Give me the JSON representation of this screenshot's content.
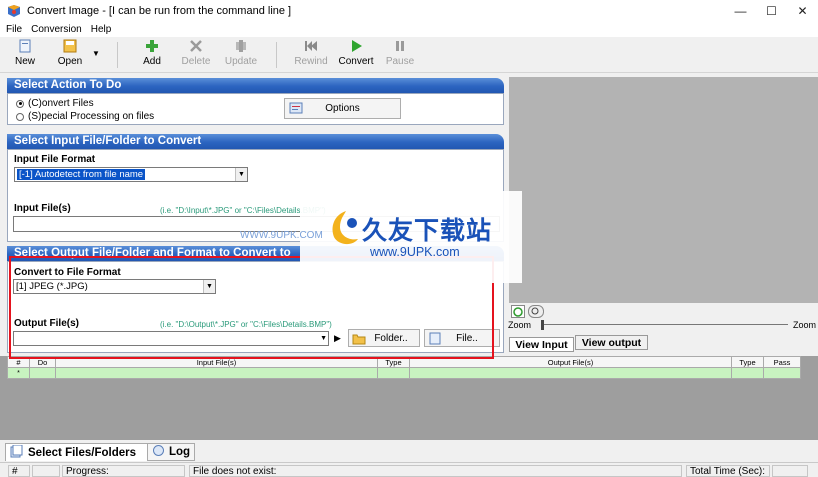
{
  "window": {
    "title": "Convert Image - [I can be run from the command line ]",
    "controls": [
      "—",
      "☐",
      "✕"
    ]
  },
  "menu": [
    "File",
    "Conversion",
    "Help"
  ],
  "toolbar": {
    "new": "New",
    "open": "Open",
    "add": "Add",
    "delete": "Delete",
    "update": "Update",
    "rewind": "Rewind",
    "convert": "Convert",
    "pause": "Pause"
  },
  "action": {
    "header": "Select Action To Do",
    "radio1": "(C)onvert Files",
    "radio2": "(S)pecial Processing on files",
    "options_button": "Options"
  },
  "input": {
    "header": "Select Input File/Folder to Convert",
    "format_label": "Input File Format",
    "format_value": "[-1] Autodetect from file name",
    "files_label": "Input File(s)",
    "hint": "(i.e. \"D:\\Input\\*.JPG\" or \"C:\\Files\\Details.BMP\")",
    "files_value": ""
  },
  "output": {
    "header": "Select Output File/Folder and Format to Convert to",
    "format_label": "Convert to File Format",
    "format_value": "[1] JPEG (*.JPG)",
    "files_label": "Output File(s)",
    "hint": "(i.e. \"D:\\Output\\*.JPG\" or \"C:\\Files\\Details.BMP\")",
    "files_value": "",
    "folder_button": "Folder..",
    "file_button": "File.."
  },
  "preview": {
    "zoom_left": "Zoom",
    "zoom_right": "Zoom",
    "view_input": "View Input",
    "view_output": "View output"
  },
  "grid": {
    "columns": [
      "#",
      "Do",
      "Input File(s)",
      "Type",
      "Output File(s)",
      "Type",
      "Pass"
    ],
    "new_row_marker": "*"
  },
  "tabs": {
    "select_files": "Select Files/Folders",
    "log": "Log"
  },
  "status": {
    "hash": "#",
    "progress": "Progress:",
    "message": "File does not exist:",
    "total_time": "Total Time (Sec):"
  },
  "watermark": {
    "main": "久友下载站",
    "url": "www.9UPK.com",
    "left": "WWW.9UPK.COM"
  },
  "colors": {
    "header_blue": "#2c64c0",
    "selection_blue": "#0a54c8",
    "grid_row_green": "#c8f3c0",
    "annotation_red": "#e5131e"
  }
}
